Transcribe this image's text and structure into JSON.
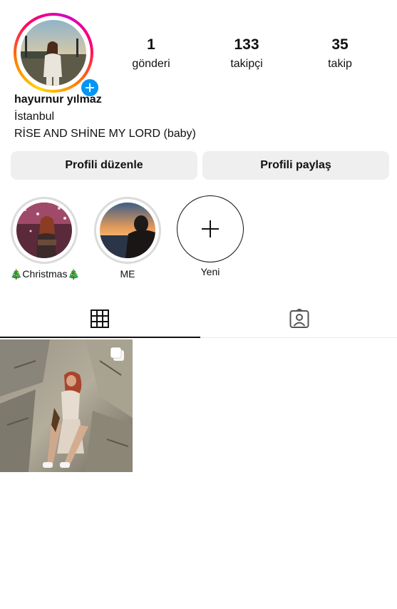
{
  "profile": {
    "username": "hayurnur yılmaz",
    "location": "İstanbul",
    "bio": "RİSE AND SHİNE MY LORD (baby)"
  },
  "stats": [
    {
      "value": "1",
      "label": "gönderi"
    },
    {
      "value": "133",
      "label": "takipçi"
    },
    {
      "value": "35",
      "label": "takip"
    }
  ],
  "buttons": {
    "edit_profile": "Profili düzenle",
    "share_profile": "Profili paylaş"
  },
  "highlights": [
    {
      "label": "🎄Christmas🎄"
    },
    {
      "label": "ME"
    },
    {
      "label": "Yeni"
    }
  ],
  "tabs": [
    {
      "icon": "grid-icon",
      "active": true
    },
    {
      "icon": "tagged-icon",
      "active": false
    }
  ],
  "posts": [
    {
      "type": "carousel",
      "icon": "multiple-posts-icon"
    }
  ],
  "colors": {
    "accent": "#0095f6",
    "button_bg": "#efefef"
  }
}
